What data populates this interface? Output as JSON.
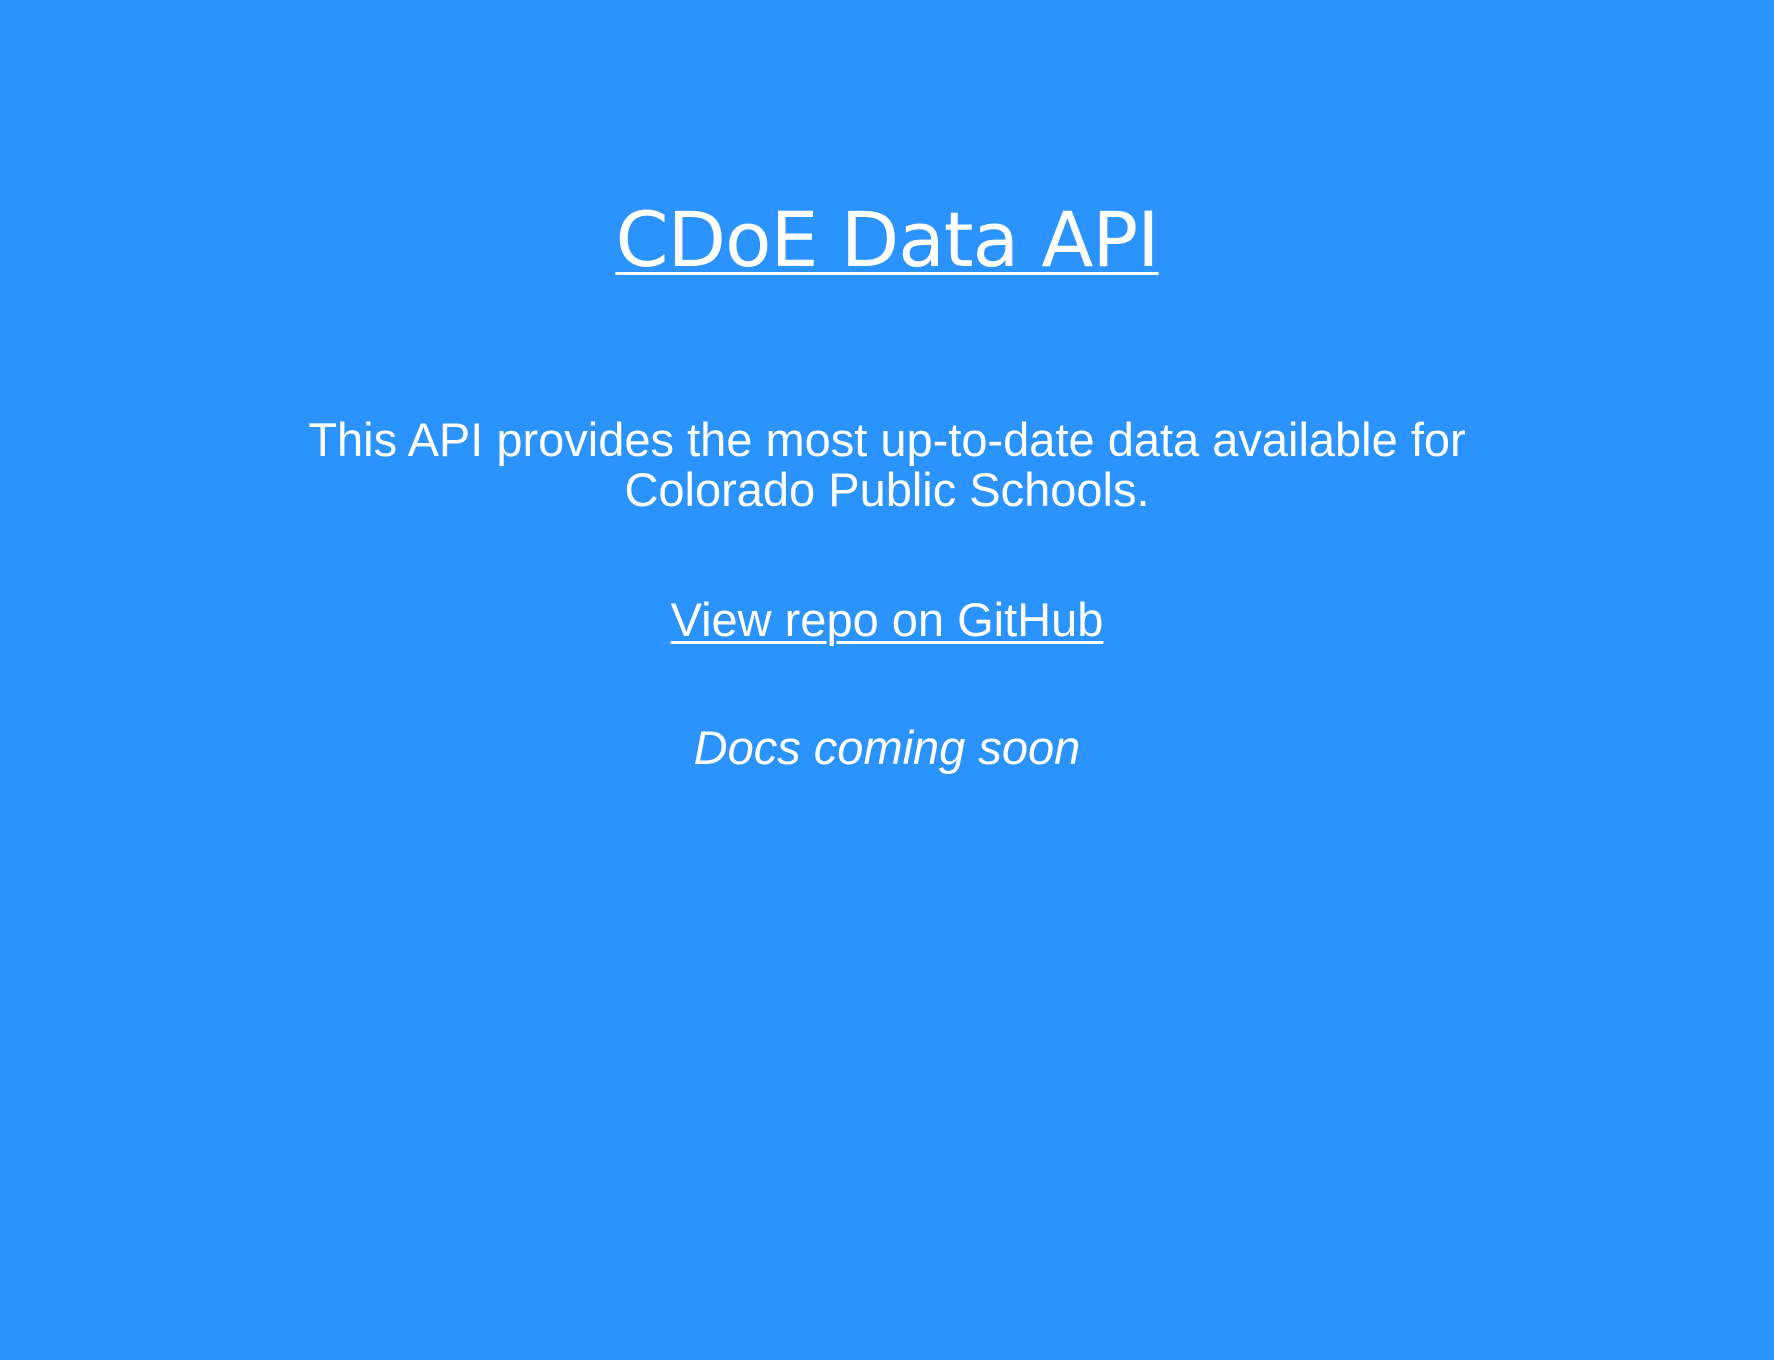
{
  "page": {
    "background_color": "#2b93fd",
    "text_color": "#ffffff"
  },
  "header": {
    "title": "CDoE Data API"
  },
  "main": {
    "description_line1": "This API provides the most up-to-date data available for",
    "description_line2": "Colorado Public Schools.",
    "repo_link_label": "View repo on GitHub",
    "docs_note": "Docs coming soon"
  }
}
